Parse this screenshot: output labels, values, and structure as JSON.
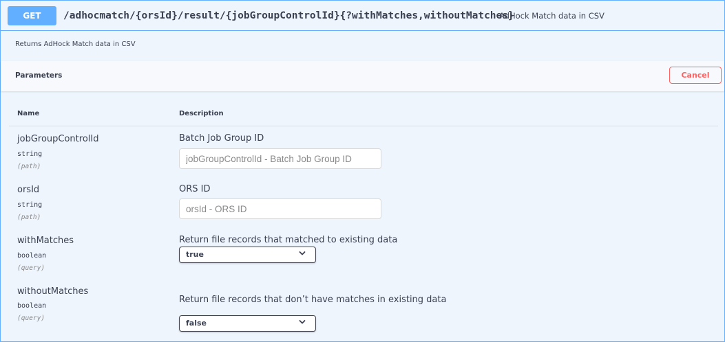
{
  "operation": {
    "method": "GET",
    "path": "/adhocmatch/{orsId}/result/{jobGroupControlId}{?withMatches,withoutMatches}",
    "summary": "AdHock Match data in CSV",
    "description": "Returns AdHock Match data in CSV",
    "method_color": "#61affe"
  },
  "parameters_section": {
    "title": "Parameters",
    "cancel_label": "Cancel",
    "cancel_color": "#ff6060"
  },
  "table": {
    "headers": {
      "name": "Name",
      "description": "Description"
    },
    "rows": [
      {
        "name": "jobGroupControlId",
        "type": "string",
        "in": "(path)",
        "description": "Batch Job Group ID",
        "input_kind": "text",
        "placeholder": "jobGroupControlId - Batch Job Group ID",
        "value": ""
      },
      {
        "name": "orsId",
        "type": "string",
        "in": "(path)",
        "description": "ORS ID",
        "input_kind": "text",
        "placeholder": "orsId - ORS ID",
        "value": ""
      },
      {
        "name": "withMatches",
        "type": "boolean",
        "in": "(query)",
        "description": "Return file records that matched to existing data",
        "input_kind": "select",
        "selected": "true"
      },
      {
        "name": "withoutMatches",
        "type": "boolean",
        "in": "(query)",
        "description": "Return file records that don’t have matches in existing data",
        "input_kind": "select",
        "selected": "false"
      }
    ]
  },
  "icons": {
    "dropdown": "chevron-down-icon"
  }
}
